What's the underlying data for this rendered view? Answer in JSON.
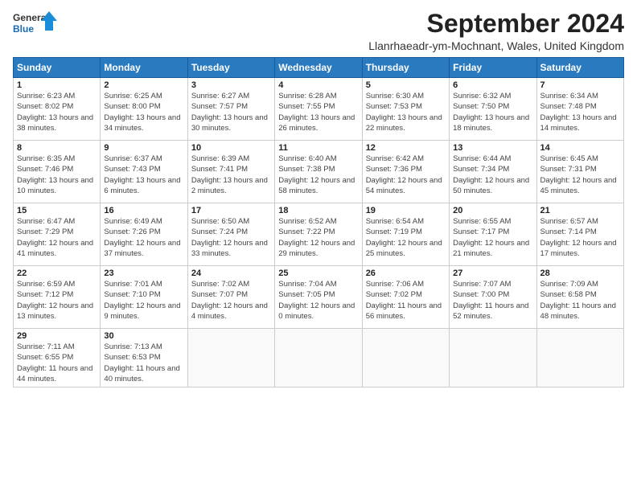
{
  "header": {
    "logo_line1": "General",
    "logo_line2": "Blue",
    "title": "September 2024",
    "location": "Llanrhaeadr-ym-Mochnant, Wales, United Kingdom"
  },
  "days_of_week": [
    "Sunday",
    "Monday",
    "Tuesday",
    "Wednesday",
    "Thursday",
    "Friday",
    "Saturday"
  ],
  "weeks": [
    [
      {
        "day": "1",
        "sunrise": "6:23 AM",
        "sunset": "8:02 PM",
        "daylight": "13 hours and 38 minutes."
      },
      {
        "day": "2",
        "sunrise": "6:25 AM",
        "sunset": "8:00 PM",
        "daylight": "13 hours and 34 minutes."
      },
      {
        "day": "3",
        "sunrise": "6:27 AM",
        "sunset": "7:57 PM",
        "daylight": "13 hours and 30 minutes."
      },
      {
        "day": "4",
        "sunrise": "6:28 AM",
        "sunset": "7:55 PM",
        "daylight": "13 hours and 26 minutes."
      },
      {
        "day": "5",
        "sunrise": "6:30 AM",
        "sunset": "7:53 PM",
        "daylight": "13 hours and 22 minutes."
      },
      {
        "day": "6",
        "sunrise": "6:32 AM",
        "sunset": "7:50 PM",
        "daylight": "13 hours and 18 minutes."
      },
      {
        "day": "7",
        "sunrise": "6:34 AM",
        "sunset": "7:48 PM",
        "daylight": "13 hours and 14 minutes."
      }
    ],
    [
      {
        "day": "8",
        "sunrise": "6:35 AM",
        "sunset": "7:46 PM",
        "daylight": "13 hours and 10 minutes."
      },
      {
        "day": "9",
        "sunrise": "6:37 AM",
        "sunset": "7:43 PM",
        "daylight": "13 hours and 6 minutes."
      },
      {
        "day": "10",
        "sunrise": "6:39 AM",
        "sunset": "7:41 PM",
        "daylight": "13 hours and 2 minutes."
      },
      {
        "day": "11",
        "sunrise": "6:40 AM",
        "sunset": "7:38 PM",
        "daylight": "12 hours and 58 minutes."
      },
      {
        "day": "12",
        "sunrise": "6:42 AM",
        "sunset": "7:36 PM",
        "daylight": "12 hours and 54 minutes."
      },
      {
        "day": "13",
        "sunrise": "6:44 AM",
        "sunset": "7:34 PM",
        "daylight": "12 hours and 50 minutes."
      },
      {
        "day": "14",
        "sunrise": "6:45 AM",
        "sunset": "7:31 PM",
        "daylight": "12 hours and 45 minutes."
      }
    ],
    [
      {
        "day": "15",
        "sunrise": "6:47 AM",
        "sunset": "7:29 PM",
        "daylight": "12 hours and 41 minutes."
      },
      {
        "day": "16",
        "sunrise": "6:49 AM",
        "sunset": "7:26 PM",
        "daylight": "12 hours and 37 minutes."
      },
      {
        "day": "17",
        "sunrise": "6:50 AM",
        "sunset": "7:24 PM",
        "daylight": "12 hours and 33 minutes."
      },
      {
        "day": "18",
        "sunrise": "6:52 AM",
        "sunset": "7:22 PM",
        "daylight": "12 hours and 29 minutes."
      },
      {
        "day": "19",
        "sunrise": "6:54 AM",
        "sunset": "7:19 PM",
        "daylight": "12 hours and 25 minutes."
      },
      {
        "day": "20",
        "sunrise": "6:55 AM",
        "sunset": "7:17 PM",
        "daylight": "12 hours and 21 minutes."
      },
      {
        "day": "21",
        "sunrise": "6:57 AM",
        "sunset": "7:14 PM",
        "daylight": "12 hours and 17 minutes."
      }
    ],
    [
      {
        "day": "22",
        "sunrise": "6:59 AM",
        "sunset": "7:12 PM",
        "daylight": "12 hours and 13 minutes."
      },
      {
        "day": "23",
        "sunrise": "7:01 AM",
        "sunset": "7:10 PM",
        "daylight": "12 hours and 9 minutes."
      },
      {
        "day": "24",
        "sunrise": "7:02 AM",
        "sunset": "7:07 PM",
        "daylight": "12 hours and 4 minutes."
      },
      {
        "day": "25",
        "sunrise": "7:04 AM",
        "sunset": "7:05 PM",
        "daylight": "12 hours and 0 minutes."
      },
      {
        "day": "26",
        "sunrise": "7:06 AM",
        "sunset": "7:02 PM",
        "daylight": "11 hours and 56 minutes."
      },
      {
        "day": "27",
        "sunrise": "7:07 AM",
        "sunset": "7:00 PM",
        "daylight": "11 hours and 52 minutes."
      },
      {
        "day": "28",
        "sunrise": "7:09 AM",
        "sunset": "6:58 PM",
        "daylight": "11 hours and 48 minutes."
      }
    ],
    [
      {
        "day": "29",
        "sunrise": "7:11 AM",
        "sunset": "6:55 PM",
        "daylight": "11 hours and 44 minutes."
      },
      {
        "day": "30",
        "sunrise": "7:13 AM",
        "sunset": "6:53 PM",
        "daylight": "11 hours and 40 minutes."
      },
      null,
      null,
      null,
      null,
      null
    ]
  ]
}
